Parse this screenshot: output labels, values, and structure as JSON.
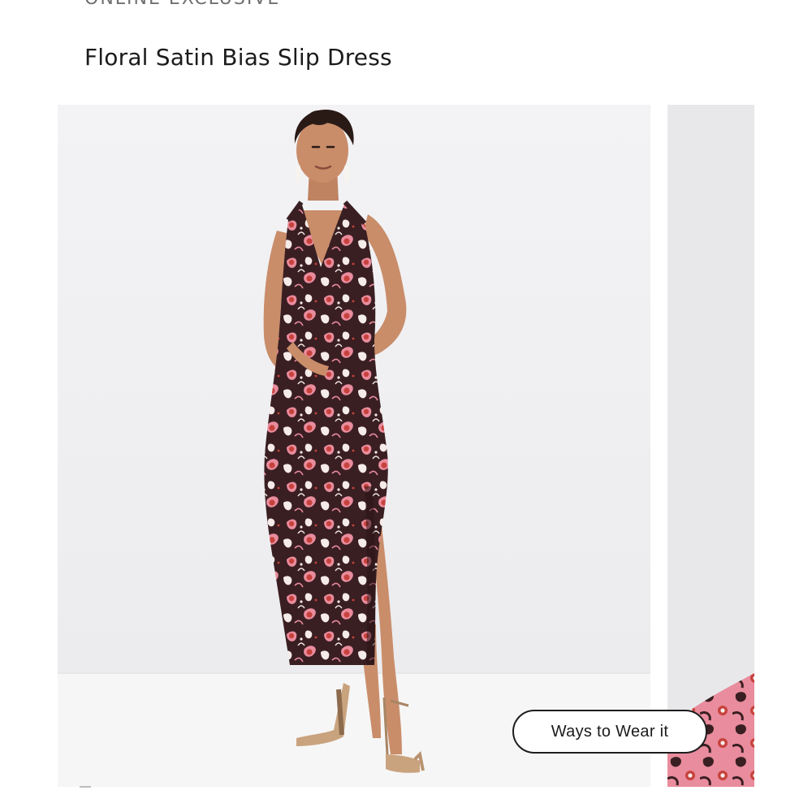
{
  "product": {
    "eyebrow": "ONLINE EXCLUSIVE",
    "title": "Floral Satin Bias Slip Dress"
  },
  "gallery": {
    "main_image_alt": "Model wearing floral satin bias slip dress",
    "next_image_alt": "Close-up of floral print",
    "ways_button_label": "Ways to Wear it"
  },
  "colors": {
    "background": "#ffffff",
    "photo_backdrop": "#f1f1f3",
    "floor": "#f6f6f6",
    "dress_base": "#3a1f22",
    "print_pink": "#e98c9d",
    "print_red": "#c7423d",
    "print_white": "#f5ebe9",
    "skin": "#c98d6a",
    "button_border": "#1d1d1d"
  }
}
